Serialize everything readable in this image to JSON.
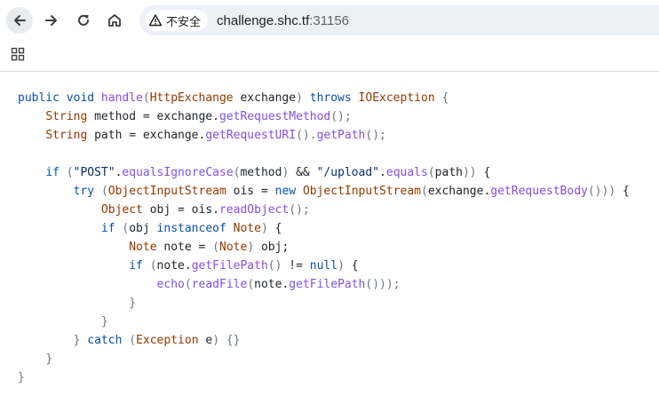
{
  "browser": {
    "security_label": "不安全",
    "url_host": "challenge.shc.tf",
    "url_port": ":31156",
    "icons": {
      "back": "arrow-left-icon",
      "forward": "arrow-right-icon",
      "reload": "reload-icon",
      "home": "home-icon",
      "security": "warning-triangle-icon",
      "apps": "apps-grid-icon"
    }
  },
  "code": {
    "language": "java",
    "lines": [
      [
        [
          "kw",
          "public void "
        ],
        [
          "fn",
          "handle"
        ],
        [
          "pu",
          "("
        ],
        [
          "ty",
          "HttpExchange"
        ],
        [
          "pl",
          " exchange"
        ],
        [
          "pu",
          ") "
        ],
        [
          "kw",
          "throws "
        ],
        [
          "ty",
          "IOException"
        ],
        [
          "pu",
          " {"
        ]
      ],
      [
        [
          "pl",
          "    "
        ],
        [
          "ty",
          "String"
        ],
        [
          "pl",
          " method = exchange."
        ],
        [
          "fn",
          "getRequestMethod"
        ],
        [
          "pu",
          "();"
        ]
      ],
      [
        [
          "pl",
          "    "
        ],
        [
          "ty",
          "String"
        ],
        [
          "pl",
          " path = exchange."
        ],
        [
          "fn",
          "getRequestURI"
        ],
        [
          "pu",
          "()."
        ],
        [
          "fn",
          "getPath"
        ],
        [
          "pu",
          "();"
        ]
      ],
      [
        [
          "pl",
          ""
        ]
      ],
      [
        [
          "pl",
          "    "
        ],
        [
          "kw",
          "if "
        ],
        [
          "pu",
          "("
        ],
        [
          "st",
          "\"POST\""
        ],
        [
          "pl",
          "."
        ],
        [
          "fn",
          "equalsIgnoreCase"
        ],
        [
          "pu",
          "("
        ],
        [
          "pl",
          "method"
        ],
        [
          "pu",
          ")"
        ],
        [
          "pl",
          " && "
        ],
        [
          "st",
          "\"/upload\""
        ],
        [
          "pl",
          "."
        ],
        [
          "fn",
          "equals"
        ],
        [
          "pu",
          "("
        ],
        [
          "pl",
          "path"
        ],
        [
          "pu",
          "))"
        ],
        [
          "pl",
          " {"
        ]
      ],
      [
        [
          "pl",
          "        "
        ],
        [
          "kw",
          "try "
        ],
        [
          "pu",
          "("
        ],
        [
          "ty",
          "ObjectInputStream"
        ],
        [
          "pl",
          " ois = "
        ],
        [
          "kw",
          "new "
        ],
        [
          "ty",
          "ObjectInputStream"
        ],
        [
          "pu",
          "("
        ],
        [
          "pl",
          "exchange."
        ],
        [
          "fn",
          "getRequestBody"
        ],
        [
          "pu",
          "()))"
        ],
        [
          "pl",
          " {"
        ]
      ],
      [
        [
          "pl",
          "            "
        ],
        [
          "ty",
          "Object"
        ],
        [
          "pl",
          " obj = ois."
        ],
        [
          "fn",
          "readObject"
        ],
        [
          "pu",
          "();"
        ]
      ],
      [
        [
          "pl",
          "            "
        ],
        [
          "kw",
          "if "
        ],
        [
          "pu",
          "("
        ],
        [
          "pl",
          "obj "
        ],
        [
          "kw",
          "instanceof "
        ],
        [
          "ty",
          "Note"
        ],
        [
          "pu",
          ")"
        ],
        [
          "pl",
          " {"
        ]
      ],
      [
        [
          "pl",
          "                "
        ],
        [
          "ty",
          "Note"
        ],
        [
          "pl",
          " note = "
        ],
        [
          "pu",
          "("
        ],
        [
          "ty",
          "Note"
        ],
        [
          "pu",
          ")"
        ],
        [
          "pl",
          " obj;"
        ]
      ],
      [
        [
          "pl",
          "                "
        ],
        [
          "kw",
          "if "
        ],
        [
          "pu",
          "("
        ],
        [
          "pl",
          "note."
        ],
        [
          "fn",
          "getFilePath"
        ],
        [
          "pu",
          "()"
        ],
        [
          "pl",
          " != "
        ],
        [
          "kw",
          "null"
        ],
        [
          "pu",
          ")"
        ],
        [
          "pl",
          " {"
        ]
      ],
      [
        [
          "pl",
          "                    "
        ],
        [
          "fn",
          "echo"
        ],
        [
          "pu",
          "("
        ],
        [
          "fn",
          "readFile"
        ],
        [
          "pu",
          "("
        ],
        [
          "pl",
          "note."
        ],
        [
          "fn",
          "getFilePath"
        ],
        [
          "pu",
          "()));"
        ]
      ],
      [
        [
          "pl",
          "                "
        ],
        [
          "pu",
          "}"
        ]
      ],
      [
        [
          "pl",
          "            "
        ],
        [
          "pu",
          "}"
        ]
      ],
      [
        [
          "pl",
          "        "
        ],
        [
          "pu",
          "} "
        ],
        [
          "kw",
          "catch "
        ],
        [
          "pu",
          "("
        ],
        [
          "ty",
          "Exception"
        ],
        [
          "pl",
          " e"
        ],
        [
          "pu",
          ") {}"
        ]
      ],
      [
        [
          "pl",
          "    "
        ],
        [
          "pu",
          "}"
        ]
      ],
      [
        [
          "pu",
          "}"
        ]
      ]
    ]
  }
}
